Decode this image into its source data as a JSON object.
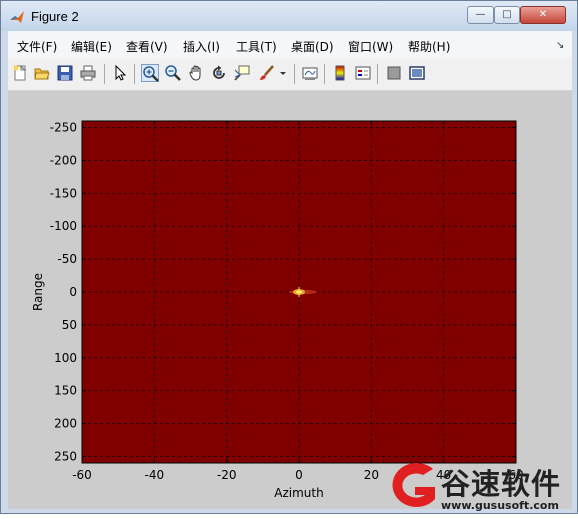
{
  "window": {
    "title": "Figure 2",
    "controls": {
      "minimize": "—",
      "maximize": "□",
      "close": "✕"
    }
  },
  "menubar": {
    "items": [
      "文件(F)",
      "编辑(E)",
      "查看(V)",
      "插入(I)",
      "工具(T)",
      "桌面(D)",
      "窗口(W)",
      "帮助(H)"
    ]
  },
  "toolbar": {
    "buttons": [
      "new-figure-icon",
      "open-file-icon",
      "save-icon",
      "print-icon",
      "edit-plot-arrow-icon",
      "zoom-in-icon",
      "zoom-out-icon",
      "pan-hand-icon",
      "rotate-3d-icon",
      "data-cursor-icon",
      "brush-icon",
      "brush-dropdown-icon",
      "link-plot-icon",
      "insert-colorbar-icon",
      "insert-legend-icon",
      "hide-plot-tools-icon",
      "show-plot-tools-icon"
    ],
    "active": "zoom-in-icon"
  },
  "chart_data": {
    "type": "heatmap",
    "xlabel": "Azimuth",
    "ylabel": "Range",
    "xlim": [
      -60,
      60
    ],
    "ylim": [
      -260,
      260
    ],
    "y_reversed": true,
    "xticks": [
      -60,
      -40,
      -20,
      0,
      20,
      40,
      60
    ],
    "yticks": [
      -250,
      -200,
      -150,
      -100,
      -50,
      0,
      50,
      100,
      150,
      200,
      250
    ],
    "grid": true,
    "background_color": "#800000",
    "peak": {
      "x": 0,
      "y": 0,
      "color": "#ffff80"
    }
  },
  "watermark": {
    "text": "谷速软件",
    "url": "www.gususoft.com"
  }
}
